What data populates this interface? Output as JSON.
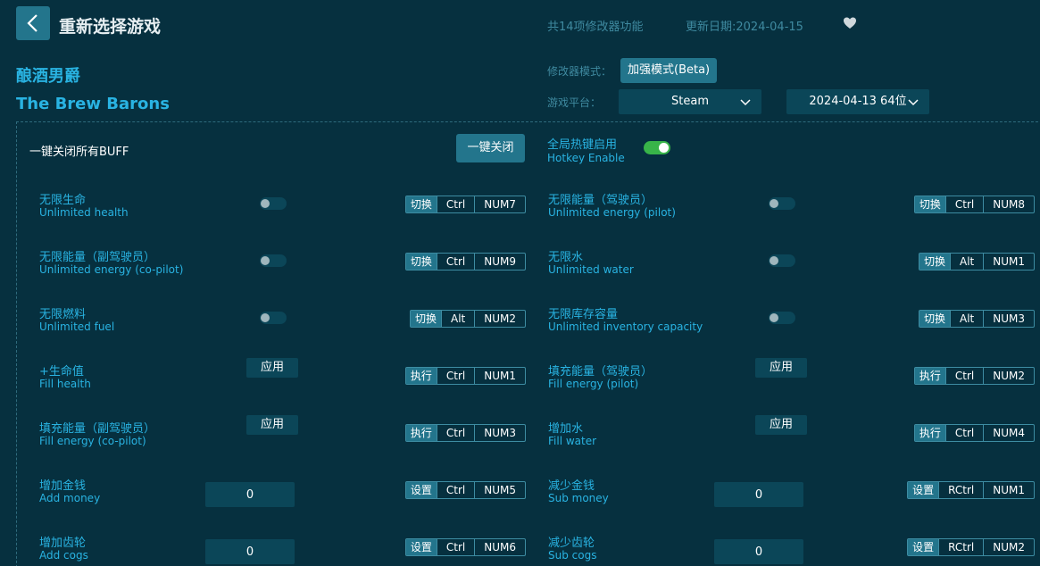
{
  "header": {
    "title": "重新选择游戏",
    "feature_count": "共14项修改器功能",
    "update_date": "更新日期:2024-04-15"
  },
  "game": {
    "name_cn": "酿酒男爵",
    "name_en": "The Brew Barons"
  },
  "settings": {
    "mode_label": "修改器模式：",
    "mode_value": "加强模式(Beta)",
    "platform_label": "游戏平台：",
    "platform_value": "Steam",
    "version_value": "2024-04-13 64位"
  },
  "global": {
    "buff_label": "一键关闭所有BUFF",
    "close_all_button": "一键关闭",
    "hotkey_cn": "全局热键启用",
    "hotkey_en": "Hotkey Enable",
    "hotkey_enabled": true
  },
  "cheats": [
    {
      "cn": "无限生命",
      "en": "Unlimited health",
      "control": "toggle",
      "action": "切换",
      "keys": [
        "Ctrl",
        "NUM7"
      ]
    },
    {
      "cn": "无限能量（驾驶员）",
      "en": "Unlimited energy (pilot)",
      "control": "toggle",
      "action": "切换",
      "keys": [
        "Ctrl",
        "NUM8"
      ]
    },
    {
      "cn": "无限能量（副驾驶员）",
      "en": "Unlimited energy (co-pilot)",
      "control": "toggle",
      "action": "切换",
      "keys": [
        "Ctrl",
        "NUM9"
      ]
    },
    {
      "cn": "无限水",
      "en": "Unlimited water",
      "control": "toggle",
      "action": "切换",
      "keys": [
        "Alt",
        "NUM1"
      ]
    },
    {
      "cn": "无限燃料",
      "en": "Unlimited fuel",
      "control": "toggle",
      "action": "切换",
      "keys": [
        "Alt",
        "NUM2"
      ]
    },
    {
      "cn": "无限库存容量",
      "en": "Unlimited inventory capacity",
      "control": "toggle",
      "action": "切换",
      "keys": [
        "Alt",
        "NUM3"
      ]
    },
    {
      "cn": "+生命值",
      "en": "Fill health",
      "control": "apply",
      "apply_label": "应用",
      "action": "执行",
      "keys": [
        "Ctrl",
        "NUM1"
      ]
    },
    {
      "cn": "填充能量（驾驶员）",
      "en": "Fill energy (pilot)",
      "control": "apply",
      "apply_label": "应用",
      "action": "执行",
      "keys": [
        "Ctrl",
        "NUM2"
      ]
    },
    {
      "cn": "填充能量（副驾驶员）",
      "en": "Fill energy (co-pilot)",
      "control": "apply",
      "apply_label": "应用",
      "action": "执行",
      "keys": [
        "Ctrl",
        "NUM3"
      ]
    },
    {
      "cn": "增加水",
      "en": "Fill water",
      "control": "apply",
      "apply_label": "应用",
      "action": "执行",
      "keys": [
        "Ctrl",
        "NUM4"
      ]
    },
    {
      "cn": "增加金钱",
      "en": "Add money",
      "control": "input",
      "input_value": "0",
      "action": "设置",
      "keys": [
        "Ctrl",
        "NUM5"
      ]
    },
    {
      "cn": "减少金钱",
      "en": "Sub money",
      "control": "input",
      "input_value": "0",
      "action": "设置",
      "keys": [
        "RCtrl",
        "NUM1"
      ]
    },
    {
      "cn": "增加齿轮",
      "en": "Add cogs",
      "control": "input",
      "input_value": "0",
      "action": "设置",
      "keys": [
        "Ctrl",
        "NUM6"
      ]
    },
    {
      "cn": "减少齿轮",
      "en": "Sub cogs",
      "control": "input",
      "input_value": "0",
      "action": "设置",
      "keys": [
        "RCtrl",
        "NUM2"
      ]
    }
  ]
}
